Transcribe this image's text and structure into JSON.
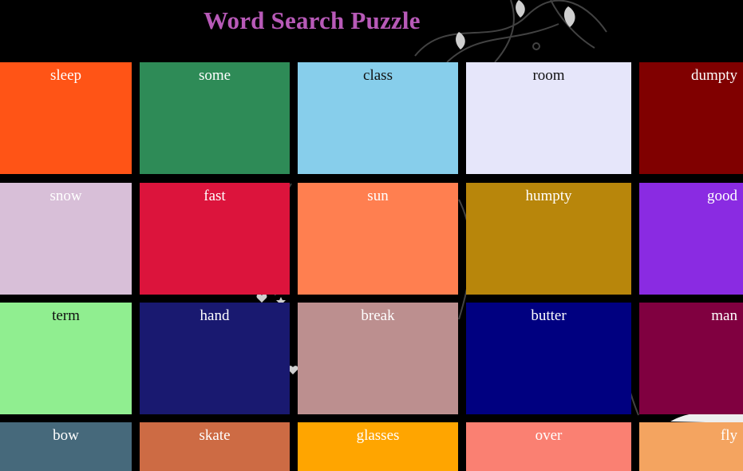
{
  "title": "Word Search Puzzle",
  "colors": {
    "background": "#000000",
    "title": "#b85ab8"
  },
  "tiles": [
    {
      "word": "sleep",
      "color": "#ff5416",
      "text": "light"
    },
    {
      "word": "some",
      "color": "#2e8b57",
      "text": "light"
    },
    {
      "word": "class",
      "color": "#87ceeb",
      "text": "dark"
    },
    {
      "word": "room",
      "color": "#e6e6fa",
      "text": "dark"
    },
    {
      "word": "dumpty",
      "color": "#800000",
      "text": "light"
    },
    {
      "word": "snow",
      "color": "#d8bfd8",
      "text": "light"
    },
    {
      "word": "fast",
      "color": "#dc143c",
      "text": "light"
    },
    {
      "word": "sun",
      "color": "#ff7f50",
      "text": "light"
    },
    {
      "word": "humpty",
      "color": "#b8860b",
      "text": "light"
    },
    {
      "word": "good",
      "color": "#8a2be2",
      "text": "light"
    },
    {
      "word": "term",
      "color": "#90ee90",
      "text": "dark"
    },
    {
      "word": "hand",
      "color": "#191970",
      "text": "light"
    },
    {
      "word": "break",
      "color": "#bc8f8f",
      "text": "light"
    },
    {
      "word": "butter",
      "color": "#000080",
      "text": "light"
    },
    {
      "word": "man",
      "color": "#800040",
      "text": "light"
    },
    {
      "word": "bow",
      "color": "#46697b",
      "text": "light"
    },
    {
      "word": "skate",
      "color": "#cd6b44",
      "text": "light"
    },
    {
      "word": "glasses",
      "color": "#ffa500",
      "text": "light"
    },
    {
      "word": "over",
      "color": "#fa8072",
      "text": "light"
    },
    {
      "word": "fly",
      "color": "#f4a460",
      "text": "light"
    }
  ]
}
